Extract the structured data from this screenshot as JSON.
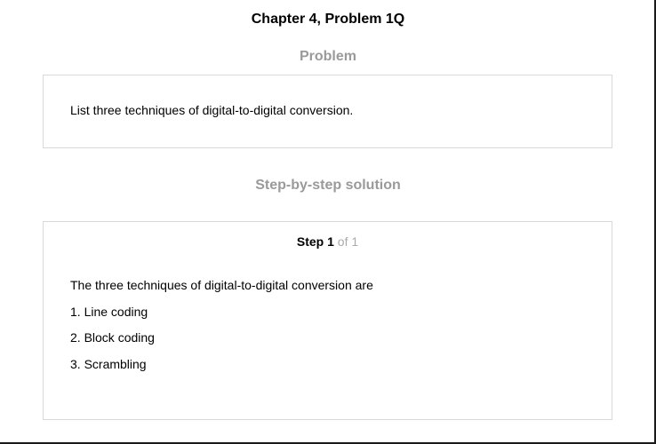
{
  "page": {
    "title": "Chapter 4, Problem 1Q"
  },
  "problem": {
    "heading": "Problem",
    "text": "List three techniques of digital-to-digital conversion."
  },
  "solution": {
    "heading": "Step-by-step solution",
    "step": {
      "label": "Step",
      "number": "1",
      "of_total": "of 1"
    },
    "lines": [
      "The three techniques of digital-to-digital conversion are",
      "1. Line coding",
      "2. Block coding",
      "3. Scrambling"
    ]
  },
  "colors": {
    "heading_gray": "#9a9a9a",
    "box_border": "#d9d9d9",
    "step_of_gray": "#aaaaaa"
  }
}
